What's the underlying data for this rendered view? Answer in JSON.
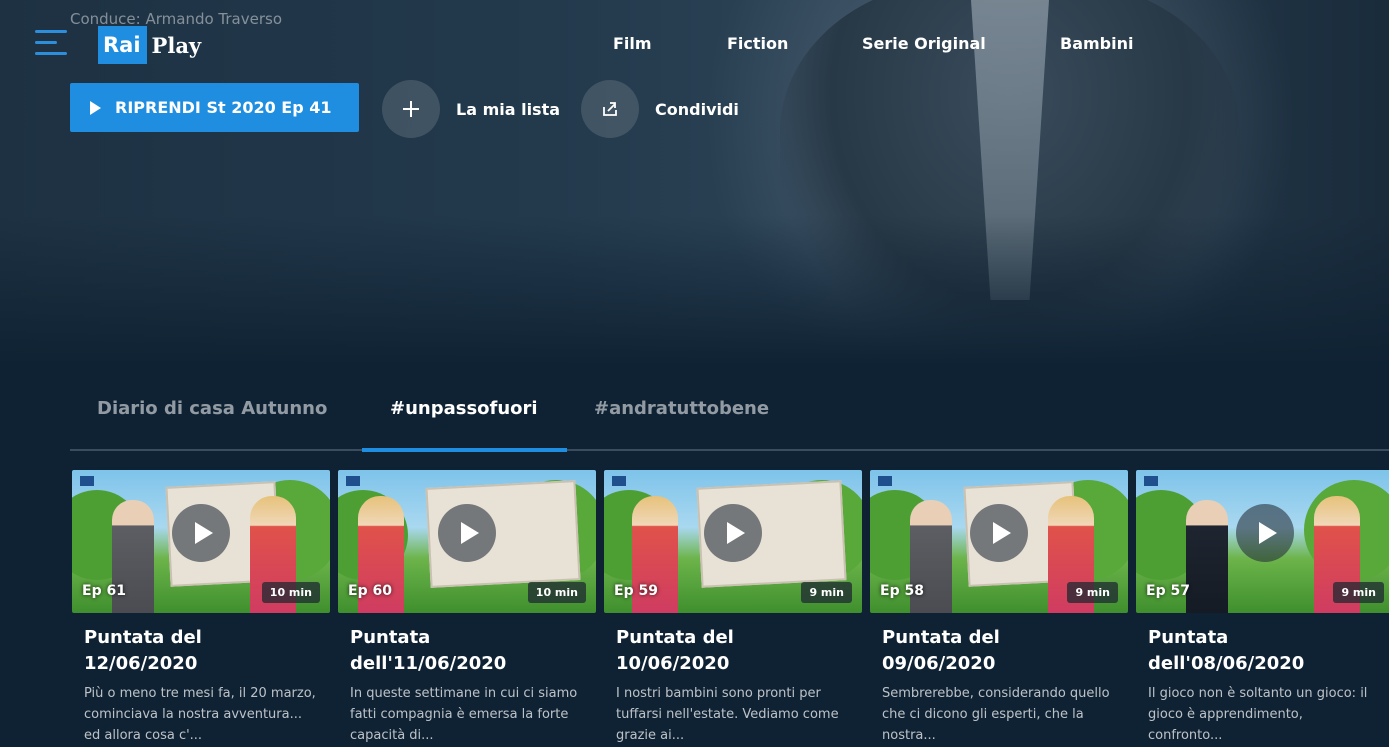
{
  "hero": {
    "conduce": "Conduce: Armando Traverso",
    "logo_rai": "Rai",
    "logo_play": "Play",
    "nav": [
      "Film",
      "Fiction",
      "Serie Original",
      "Bambini"
    ],
    "resume_label": "RIPRENDI St 2020 Ep 41",
    "mylist_label": "La mia lista",
    "share_label": "Condividi"
  },
  "tabs": [
    "Diario di casa Autunno",
    "#unpassofuori",
    "#andratuttobene"
  ],
  "active_tab": "#unpassofuori",
  "episodes": [
    {
      "ep": "Ep 61",
      "duration": "10 min",
      "title": "Puntata del 12/06/2020",
      "desc": "Più o meno tre mesi fa, il 20 marzo, cominciava la nostra avventura... ed allora cosa c'..."
    },
    {
      "ep": "Ep 60",
      "duration": "10 min",
      "title": "Puntata dell'11/06/2020",
      "desc": "In queste settimane in cui ci siamo fatti compagnia è emersa la forte capacità di..."
    },
    {
      "ep": "Ep 59",
      "duration": "9 min",
      "title": "Puntata del 10/06/2020",
      "desc": "I nostri bambini sono pronti per tuffarsi nell'estate. Vediamo come grazie ai..."
    },
    {
      "ep": "Ep 58",
      "duration": "9 min",
      "title": "Puntata del 09/06/2020",
      "desc": "Sembrerebbe, considerando quello che ci dicono gli esperti, che la nostra..."
    },
    {
      "ep": "Ep 57",
      "duration": "9 min",
      "title": "Puntata dell'08/06/2020",
      "desc": "Il gioco non è soltanto un gioco: il gioco è apprendimento, confronto..."
    }
  ],
  "colors": {
    "accent": "#1f8ee0",
    "background": "#0f2233"
  },
  "icons": [
    "menu-icon",
    "play-icon",
    "plus-icon",
    "share-icon"
  ]
}
